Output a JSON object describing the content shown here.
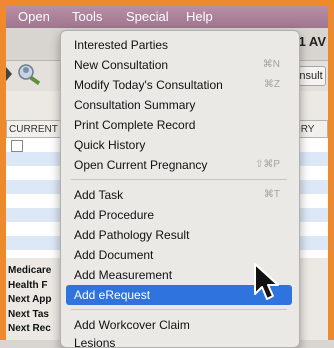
{
  "menubar": {
    "items": [
      "Open",
      "Tools",
      "Special",
      "Help"
    ]
  },
  "window": {
    "title_fragment": "31 AV",
    "consult_button": "onsult"
  },
  "table": {
    "left_header": "CURRENT",
    "right_header": "TORY"
  },
  "side_labels": [
    "Medicare",
    "Health F",
    "Next App",
    "Next Tas",
    "Next Rec"
  ],
  "menu": {
    "items": [
      {
        "label": "Interested Parties",
        "shortcut": ""
      },
      {
        "label": "New Consultation",
        "shortcut": "⌘N"
      },
      {
        "label": "Modify Today's Consultation",
        "shortcut": "⌘Z"
      },
      {
        "label": "Consultation Summary",
        "shortcut": ""
      },
      {
        "label": "Print Complete Record",
        "shortcut": ""
      },
      {
        "label": "Quick History",
        "shortcut": ""
      },
      {
        "label": "Open Current Pregnancy",
        "shortcut": "⇧⌘P"
      },
      {
        "label": "Add Task",
        "shortcut": "⌘T"
      },
      {
        "label": "Add Procedure",
        "shortcut": ""
      },
      {
        "label": "Add Pathology Result",
        "shortcut": ""
      },
      {
        "label": "Add Document",
        "shortcut": ""
      },
      {
        "label": "Add Measurement",
        "shortcut": ""
      },
      {
        "label": "Add eRequest",
        "shortcut": ""
      },
      {
        "label": "Add Workcover Claim",
        "shortcut": ""
      },
      {
        "label": "Lesions",
        "shortcut": ""
      }
    ],
    "selected_index": 12
  },
  "colors": {
    "frame": "#ef8a2c",
    "highlight": "#2f74de",
    "menubar": "#a87e97"
  },
  "icons": {
    "toolbar": "patient-search-icon",
    "pointer": "arrow-cursor-icon"
  }
}
